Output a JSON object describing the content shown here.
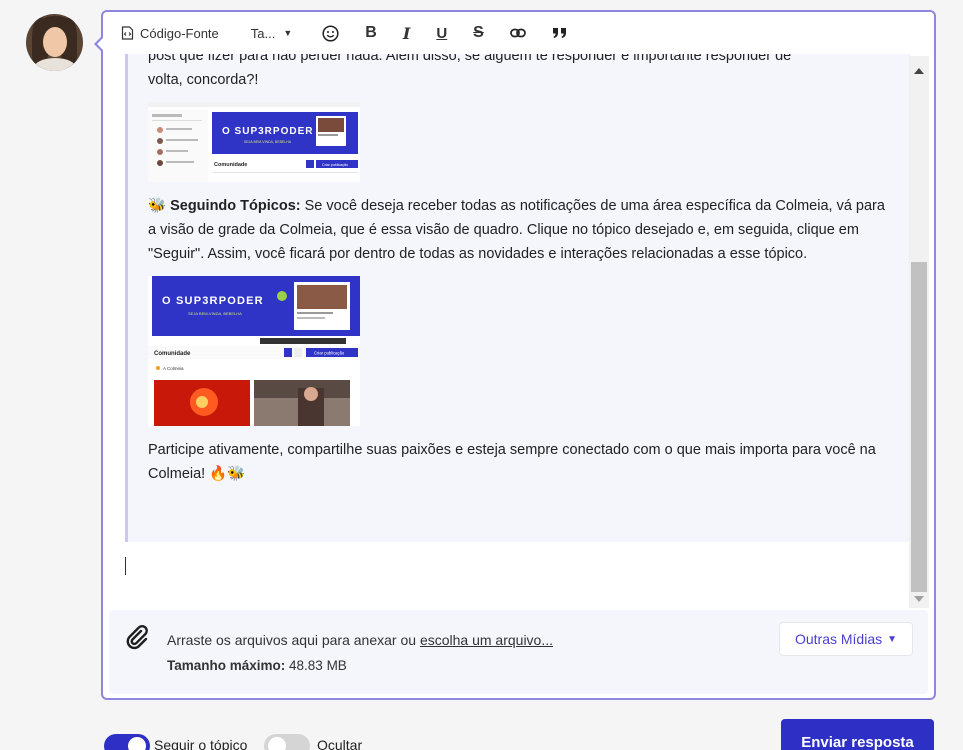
{
  "toolbar": {
    "source_label": "Código-Fonte",
    "size_label": "Ta...",
    "bold": "B",
    "italic": "I",
    "underline": "U",
    "strike": "S",
    "quote": "”"
  },
  "content": {
    "cut_line": "post que fizer para não perder nada. Além disso, se alguém te responder é importante responder de",
    "p1_line": "volta, concorda?!",
    "shot1": {
      "brand": "O SUP3RPODER",
      "subtitle": "SEJA BEM-VINDA, BEBELHA",
      "section": "Comunidade",
      "button": "Criar publicação"
    },
    "p2_emoji": "🐝",
    "p2_title": "Seguindo Tópicos:",
    "p2_text": " Se você deseja receber todas as notificações de uma área específica da Colmeia, vá para a visão de grade da Colmeia, que é essa visão de quadro. Clique no tópico desejado e, em seguida, clique em \"Seguir\". Assim, você ficará por dentro de todas as novidades e interações relacionadas a esse tópico.",
    "shot2": {
      "brand": "O SUP3RPODER",
      "subtitle": "SEJA BEM-VINDA, BEBELHA",
      "section": "Comunidade",
      "button": "Criar publicação",
      "topic": "A Colmeia"
    },
    "p3_text": "Participe ativamente, compartilhe suas paixões e esteja sempre conectado com o que mais importa para você na Colmeia! ",
    "p3_emoji": "🔥🐝"
  },
  "attach": {
    "drop_text": "Arraste os arquivos aqui para anexar ou ",
    "choose_link": "escolha um arquivo...",
    "max_label": "Tamanho máximo:",
    "max_value": " 48.83 MB",
    "other_media": "Outras Mídias"
  },
  "bottom": {
    "follow_label": "Seguir o tópico",
    "follow_on": true,
    "hide_label": "Ocultar",
    "hide_on": false,
    "send_label": "Enviar resposta"
  },
  "colors": {
    "accent": "#2d2fc5",
    "editor_border": "#8f86e0",
    "banner": "#2f34c6"
  }
}
